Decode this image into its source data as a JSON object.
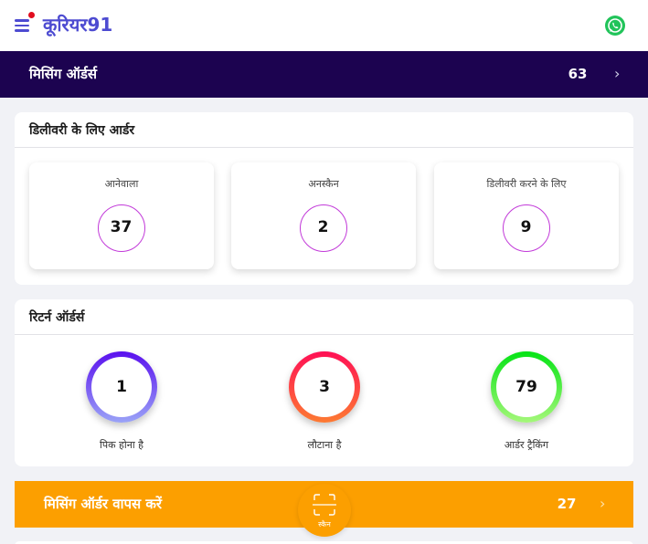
{
  "header": {
    "brand": "कूरियर91",
    "icons": {
      "menu": "hamburger-menu-icon",
      "whatsapp": "whatsapp-icon"
    },
    "colors": {
      "brand": "#4d4bd1",
      "notification": "#e10e1f",
      "whatsapp": "#21c45a"
    }
  },
  "missing_orders": {
    "label": "मिसिंग ऑर्डर्स",
    "count": "63",
    "background": "#1c0350"
  },
  "delivery": {
    "title": "डिलीवरी के लिए आर्डर",
    "items": [
      {
        "label": "आनेवाला",
        "value": "37"
      },
      {
        "label": "अनस्कैन",
        "value": "2"
      },
      {
        "label": "डिलीवरी करने के लिए",
        "value": "9"
      }
    ]
  },
  "returns": {
    "title": "रिटर्न ऑर्डर्स",
    "items": [
      {
        "label": "पिक होना है",
        "value": "1",
        "gradient": [
          "#5a10ee",
          "#9aa3f7"
        ]
      },
      {
        "label": "लौटाना है",
        "value": "3",
        "gradient": [
          "#ff0f55",
          "#fd7a32"
        ]
      },
      {
        "label": "आर्डर ट्रैकिंग",
        "value": "79",
        "gradient": [
          "#05e315",
          "#a5f77a"
        ]
      }
    ]
  },
  "return_missing": {
    "label": "मिसिंग ऑर्डर वापस करें",
    "count": "27",
    "background": "#fc9f00"
  },
  "scan": {
    "label": "स्कैन",
    "icon": "scan-frame-icon"
  }
}
